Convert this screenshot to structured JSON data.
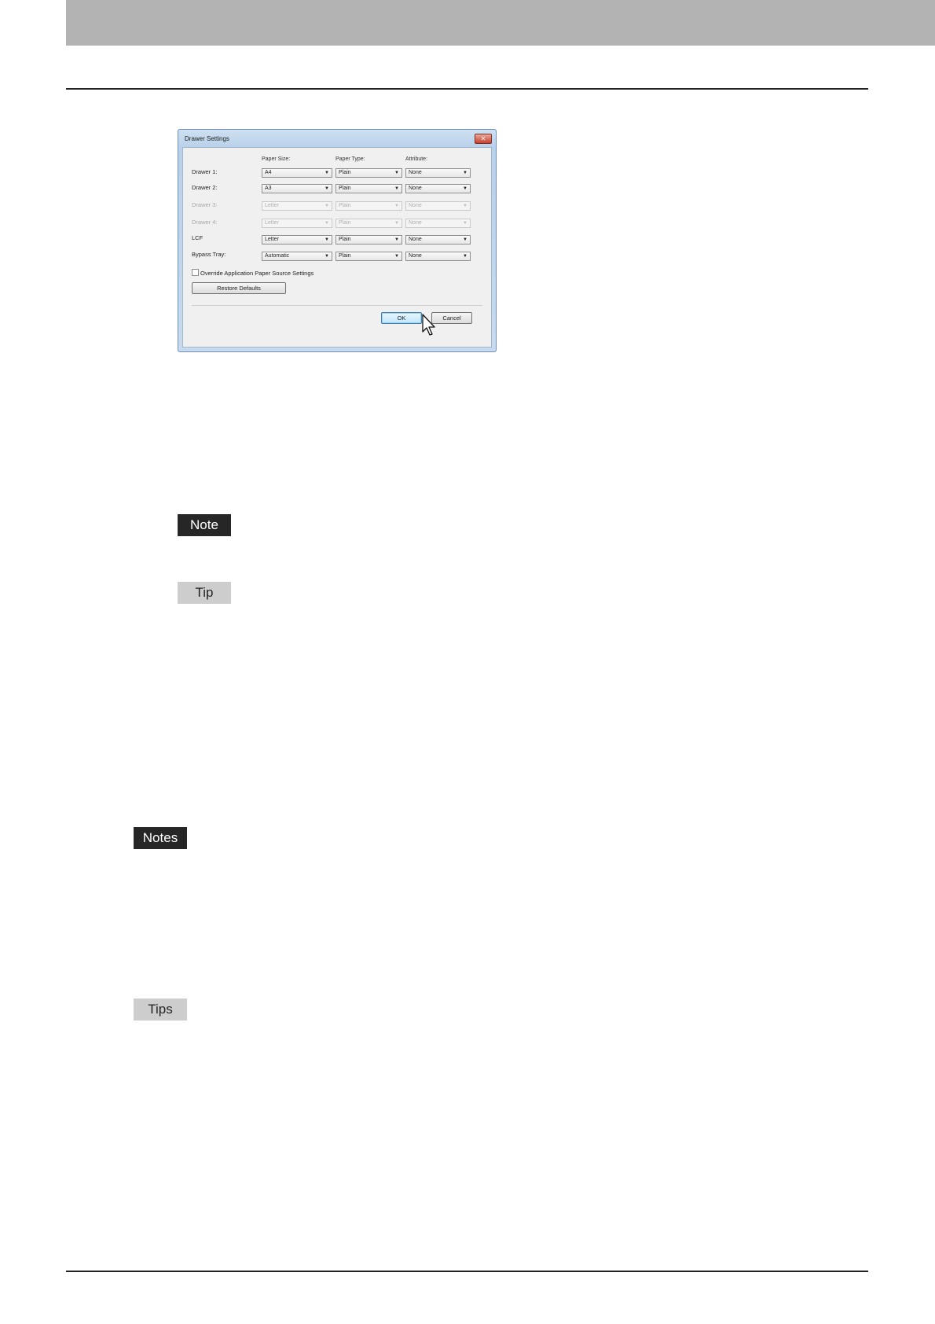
{
  "dialog": {
    "title": "Drawer Settings",
    "close_glyph": "✕",
    "columns": {
      "paper_size": "Paper Size:",
      "paper_type": "Paper Type:",
      "attribute": "Attribute:"
    },
    "rows": [
      {
        "label": "Drawer 1:",
        "size": "A4",
        "type": "Plain",
        "attribute": "None",
        "enabled": true
      },
      {
        "label": "Drawer 2:",
        "size": "A3",
        "type": "Plain",
        "attribute": "None",
        "enabled": true
      },
      {
        "label": "Drawer 3:",
        "size": "Letter",
        "type": "Plain",
        "attribute": "None",
        "enabled": false
      },
      {
        "label": "Drawer 4:",
        "size": "Letter",
        "type": "Plain",
        "attribute": "None",
        "enabled": false
      },
      {
        "label": "LCF",
        "size": "Letter",
        "type": "Plain",
        "attribute": "None",
        "enabled": true
      },
      {
        "label": "Bypass Tray:",
        "size": "Automatic",
        "type": "Plain",
        "attribute": "None",
        "enabled": true
      }
    ],
    "override_label": "Override Application Paper Source Settings",
    "override_checked": false,
    "restore_label": "Restore Defaults",
    "ok_label": "OK",
    "cancel_label": "Cancel"
  },
  "labels": {
    "note": "Note",
    "tip": "Tip",
    "notes": "Notes",
    "tips": "Tips"
  },
  "colors": {
    "header_band": "#b3b3b3",
    "note_bg": "#262626",
    "tip_bg": "#cdcdcd"
  }
}
